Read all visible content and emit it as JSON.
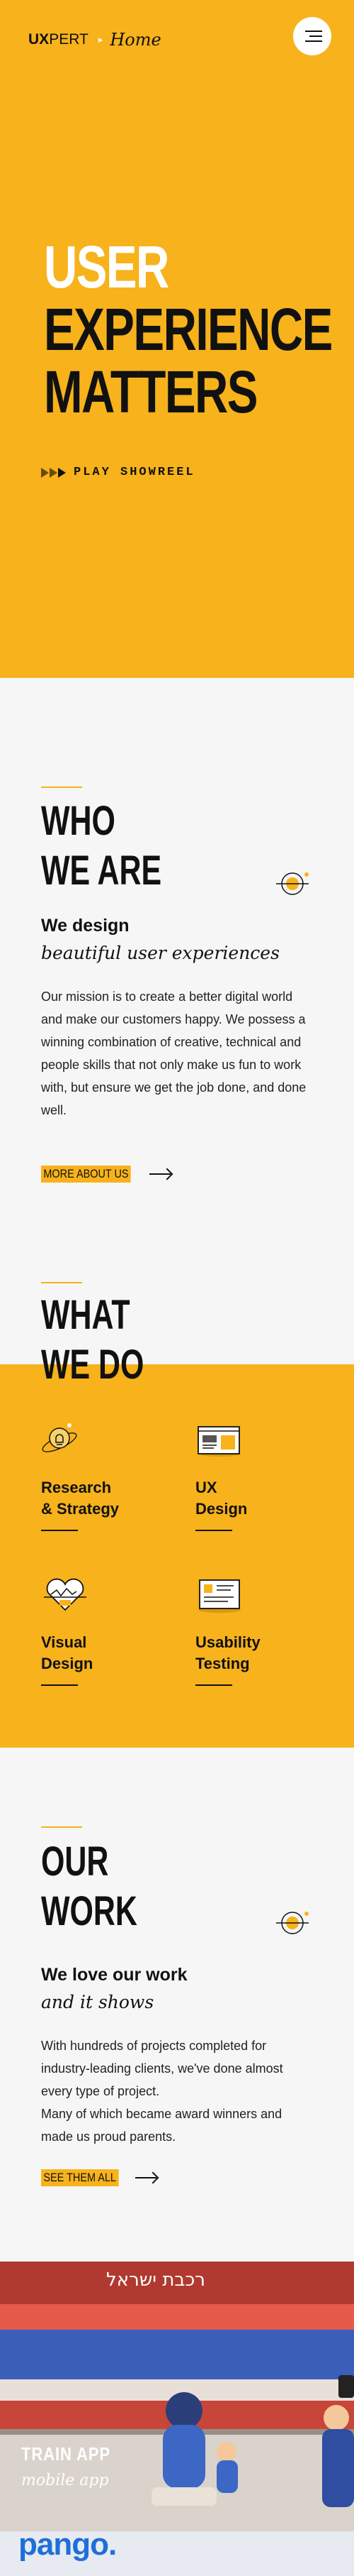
{
  "header": {
    "logo_ux": "UX",
    "logo_pert": "PERT",
    "breadcrumb_separator": "▸",
    "breadcrumb_current": "Home",
    "menu_icon": "hamburger-icon"
  },
  "hero": {
    "title_lines": [
      "USER",
      "EXPERIENCE",
      "MATTERS"
    ],
    "showreel_label": "PLAY SHOWREEL",
    "play_icon": "play-icon"
  },
  "who_we_are": {
    "title_lines": [
      "WHO",
      "WE ARE"
    ],
    "subtitle": "We design",
    "subtitle_italic": "beautiful user experiences",
    "body": "Our mission is to create a better digital world and make our customers happy. We possess a winning combination of creative, technical and people skills that not only make us fun to work with, but ensure we get the job done, and done well.",
    "cta": "MORE ABOUT US"
  },
  "what_we_do": {
    "title_lines": [
      "WHAT",
      "WE DO"
    ],
    "services": [
      {
        "line1": "Research",
        "line2": "& Strategy",
        "icon": "brain-bulb-icon"
      },
      {
        "line1": "UX",
        "line2": "Design",
        "icon": "browser-wireframe-icon"
      },
      {
        "line1": "Visual",
        "line2": "Design",
        "icon": "heart-design-icon"
      },
      {
        "line1": "Usability",
        "line2": "Testing",
        "icon": "usability-testing-icon"
      }
    ]
  },
  "our_work": {
    "title_lines": [
      "OUR",
      "WORK"
    ],
    "subtitle": "We love our work",
    "subtitle_italic": "and it shows",
    "body": "With hundreds of projects completed for industry-leading clients, we've done almost every type of project.\nMany of which became award winners and made us proud parents.",
    "cta": "SEE THEM ALL"
  },
  "featured_project": {
    "title": "TRAIN APP",
    "subtitle": "mobile app",
    "next_brand": "pango."
  },
  "colors": {
    "accent": "#f7b21c",
    "text": "#111111",
    "background": "#f6f6f6",
    "brand_blue": "#1f6fd8"
  }
}
